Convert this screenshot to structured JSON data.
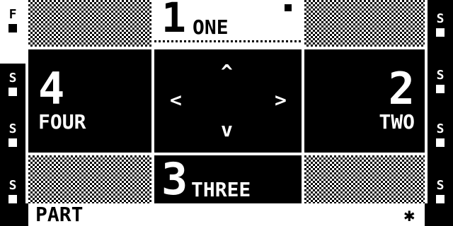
{
  "rail_left": {
    "items": [
      {
        "glyph": "F",
        "active": true
      },
      {
        "glyph": "S",
        "active": false
      },
      {
        "glyph": "S",
        "active": false
      },
      {
        "glyph": "S",
        "active": false
      }
    ]
  },
  "rail_right": {
    "items": [
      {
        "glyph": "S"
      },
      {
        "glyph": "S"
      },
      {
        "glyph": "S"
      },
      {
        "glyph": "S"
      }
    ]
  },
  "channels": {
    "top": {
      "number": "1",
      "label": "ONE"
    },
    "right": {
      "number": "2",
      "label": "TWO"
    },
    "bottom": {
      "number": "3",
      "label": "THREE"
    },
    "left": {
      "number": "4",
      "label": "FOUR"
    }
  },
  "dpad": {
    "up": "^",
    "down": "v",
    "left": "<",
    "right": ">"
  },
  "footer": {
    "label": "PART",
    "icon": "asterisk-icon"
  }
}
